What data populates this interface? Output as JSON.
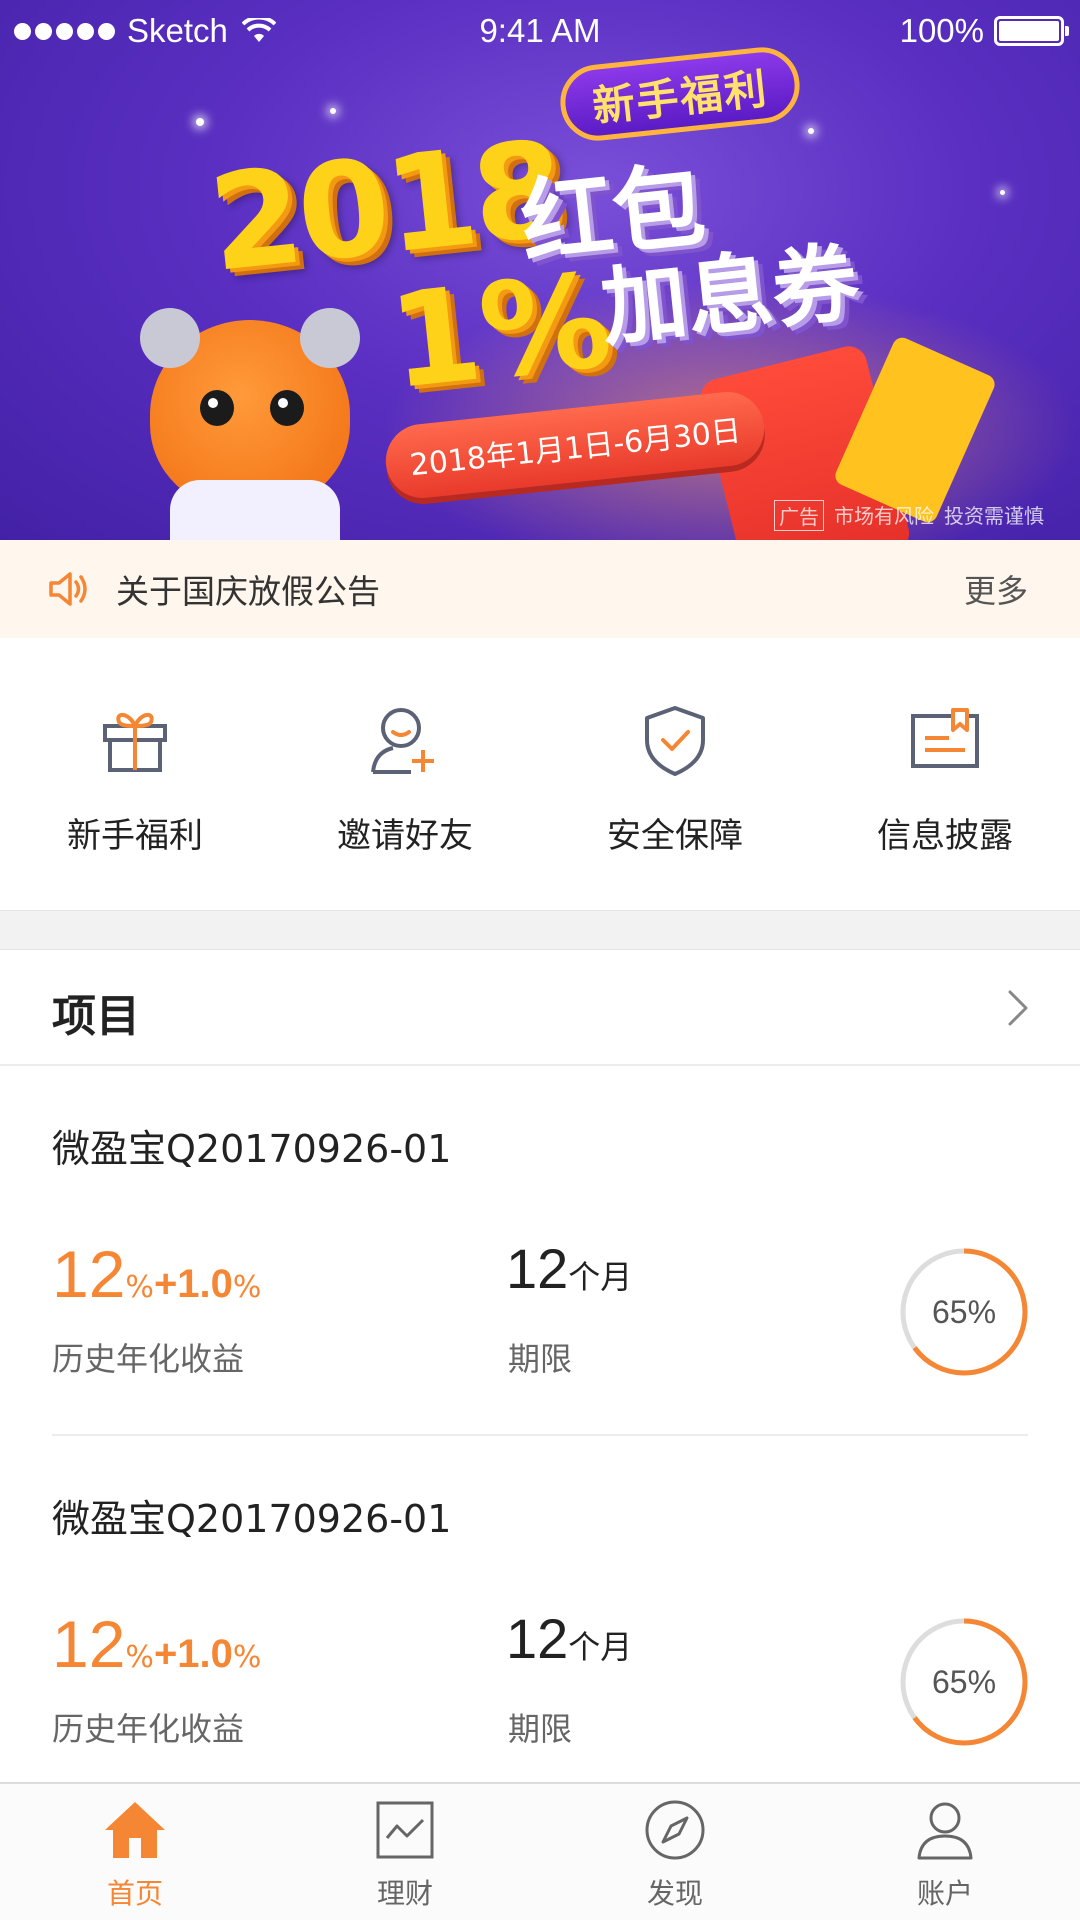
{
  "status_bar": {
    "carrier": "Sketch",
    "time": "9:41 AM",
    "battery": "100%"
  },
  "banner": {
    "tag": "新手福利",
    "headline_year": "2018",
    "headline_hongbao": "红包",
    "headline_rate": "1%",
    "headline_coupon": "加息券",
    "date_range": "2018年1月1日-6月30日",
    "ad_label": "广告",
    "risk_notice": "市场有风险",
    "caution": "投资需谨慎"
  },
  "notice": {
    "text": "关于国庆放假公告",
    "more": "更多"
  },
  "quick_menu": [
    {
      "label": "新手福利",
      "icon": "gift-icon"
    },
    {
      "label": "邀请好友",
      "icon": "add-friend-icon"
    },
    {
      "label": "安全保障",
      "icon": "shield-check-icon"
    },
    {
      "label": "信息披露",
      "icon": "disclosure-icon"
    }
  ],
  "projects": {
    "title": "项目",
    "items": [
      {
        "name": "微盈宝Q20170926-01",
        "rate": "12",
        "rate_unit": "%",
        "rate_extra": "+1.0",
        "rate_extra_unit": "%",
        "rate_label": "历史年化收益",
        "term": "12",
        "term_unit": "个月",
        "term_label": "期限",
        "progress": 65,
        "progress_text": "65%"
      },
      {
        "name": "微盈宝Q20170926-01",
        "rate": "12",
        "rate_unit": "%",
        "rate_extra": "+1.0",
        "rate_extra_unit": "%",
        "rate_label": "历史年化收益",
        "term": "12",
        "term_unit": "个月",
        "term_label": "期限",
        "progress": 65,
        "progress_text": "65%"
      }
    ]
  },
  "tab_bar": [
    {
      "label": "首页",
      "icon": "home-icon",
      "active": true
    },
    {
      "label": "理财",
      "icon": "chart-icon",
      "active": false
    },
    {
      "label": "发现",
      "icon": "compass-icon",
      "active": false
    },
    {
      "label": "账户",
      "icon": "user-icon",
      "active": false
    }
  ],
  "colors": {
    "accent": "#f58634",
    "banner_bg": "#5a2fc2",
    "notice_bg": "#fff7ee",
    "progress_track": "#dddddd"
  }
}
